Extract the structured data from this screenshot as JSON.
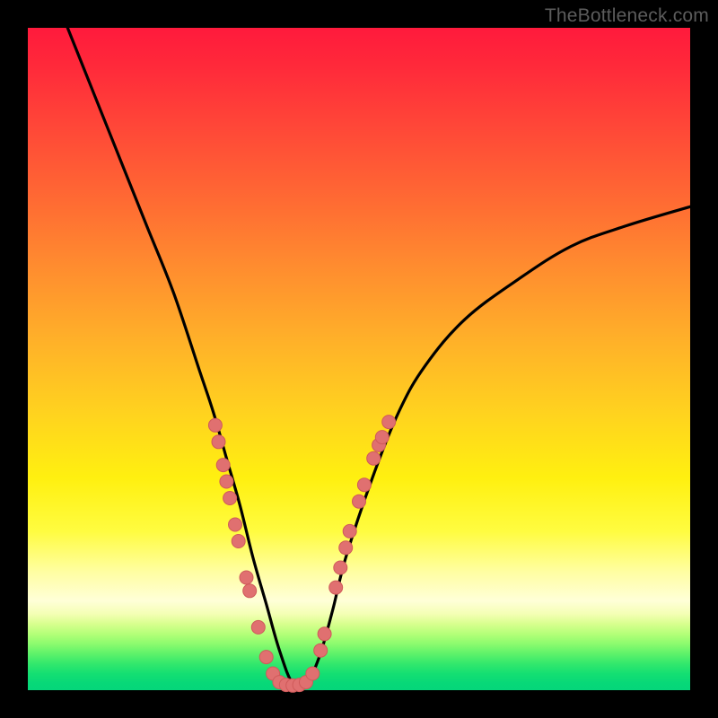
{
  "watermark": "TheBottleneck.com",
  "colors": {
    "frame": "#000000",
    "curve": "#000000",
    "marker_fill": "#e07070",
    "marker_stroke": "#cf5a5a"
  },
  "chart_data": {
    "type": "line",
    "title": "",
    "xlabel": "",
    "ylabel": "",
    "xlim": [
      0,
      100
    ],
    "ylim": [
      0,
      100
    ],
    "x_at_min": 40,
    "series": [
      {
        "name": "bottleneck-curve",
        "x": [
          6,
          10,
          14,
          18,
          22,
          26,
          28,
          30,
          32,
          34,
          36,
          38,
          40,
          42,
          44,
          46,
          48,
          52,
          56,
          60,
          66,
          74,
          82,
          90,
          100
        ],
        "y": [
          100,
          90,
          80,
          70,
          60,
          48,
          42,
          35,
          28,
          20,
          13,
          6,
          1,
          1,
          5,
          12,
          20,
          32,
          42,
          49,
          56,
          62,
          67,
          70,
          73
        ]
      }
    ],
    "markers": {
      "name": "highlighted-points",
      "points": [
        {
          "x": 28.3,
          "y": 40.0
        },
        {
          "x": 28.8,
          "y": 37.5
        },
        {
          "x": 29.5,
          "y": 34.0
        },
        {
          "x": 30.0,
          "y": 31.5
        },
        {
          "x": 30.5,
          "y": 29.0
        },
        {
          "x": 31.3,
          "y": 25.0
        },
        {
          "x": 31.8,
          "y": 22.5
        },
        {
          "x": 33.0,
          "y": 17.0
        },
        {
          "x": 33.5,
          "y": 15.0
        },
        {
          "x": 34.8,
          "y": 9.5
        },
        {
          "x": 36.0,
          "y": 5.0
        },
        {
          "x": 37.0,
          "y": 2.5
        },
        {
          "x": 38.0,
          "y": 1.2
        },
        {
          "x": 39.0,
          "y": 0.8
        },
        {
          "x": 40.0,
          "y": 0.7
        },
        {
          "x": 41.0,
          "y": 0.8
        },
        {
          "x": 42.0,
          "y": 1.2
        },
        {
          "x": 43.0,
          "y": 2.5
        },
        {
          "x": 44.2,
          "y": 6.0
        },
        {
          "x": 44.8,
          "y": 8.5
        },
        {
          "x": 46.5,
          "y": 15.5
        },
        {
          "x": 47.2,
          "y": 18.5
        },
        {
          "x": 48.0,
          "y": 21.5
        },
        {
          "x": 48.6,
          "y": 24.0
        },
        {
          "x": 50.0,
          "y": 28.5
        },
        {
          "x": 50.8,
          "y": 31.0
        },
        {
          "x": 52.2,
          "y": 35.0
        },
        {
          "x": 53.0,
          "y": 37.0
        },
        {
          "x": 53.5,
          "y": 38.2
        },
        {
          "x": 54.5,
          "y": 40.5
        }
      ]
    }
  }
}
